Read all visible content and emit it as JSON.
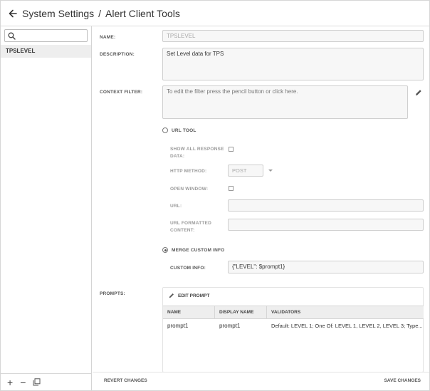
{
  "header": {
    "title_primary": "System Settings",
    "separator": "/",
    "title_secondary": "Alert Client Tools"
  },
  "sidebar": {
    "search_placeholder": "",
    "items": [
      {
        "label": "TPSLEVEL",
        "selected": true
      }
    ],
    "footer": {
      "add": "+",
      "remove": "−"
    }
  },
  "form": {
    "name_label": "NAME:",
    "name_value": "TPSLEVEL",
    "description_label": "DESCRIPTION:",
    "description_value": "Set Level data for TPS",
    "context_filter_label": "CONTEXT FILTER:",
    "context_filter_placeholder": "To edit the filter press the pencil button or click here.",
    "url_tool_label": "URL TOOL",
    "show_all_response_label_1": "SHOW ALL RESPONSE",
    "show_all_response_label_2": "DATA:",
    "http_method_label": "HTTP METHOD:",
    "http_method_value": "POST",
    "open_window_label": "OPEN WINDOW:",
    "url_label": "URL:",
    "url_formatted_label_1": "URL FORMATTED",
    "url_formatted_label_2": "CONTENT:",
    "merge_custom_info_label": "MERGE CUSTOM INFO",
    "custom_info_label": "CUSTOM INFO:",
    "custom_info_value": "{\"LEVEL\": $prompt1}",
    "selected_mode": "merge_custom_info"
  },
  "prompts": {
    "label": "PROMPTS:",
    "edit_button": "EDIT PROMPT",
    "columns": [
      "NAME",
      "DISPLAY NAME",
      "VALIDATORS"
    ],
    "rows": [
      [
        "prompt1",
        "prompt1",
        "Default: LEVEL 1; One Of: LEVEL 1, LEVEL 2, LEVEL 3; Type..."
      ]
    ]
  },
  "actions": {
    "revert": "REVERT CHANGES",
    "save": "SAVE CHANGES"
  },
  "colors": {
    "border": "#d6d6d6",
    "field_bg": "#f7f7f7",
    "selected_bg": "#eeeeee"
  }
}
